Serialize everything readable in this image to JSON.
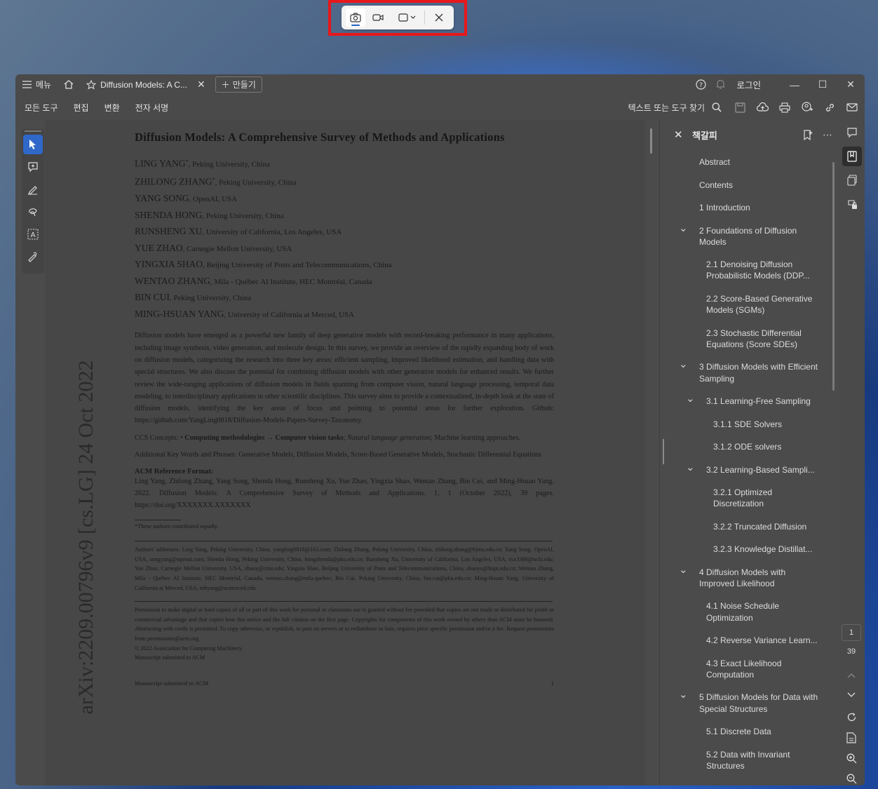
{
  "capture_toolbar": {
    "modes": [
      "camera-icon",
      "video-icon",
      "region-icon"
    ],
    "active_mode": "camera-icon"
  },
  "titlebar": {
    "menu_label": "메뉴",
    "tab_title": "Diffusion Models: A C...",
    "new_tab_label": "만들기",
    "login_label": "로그인"
  },
  "menubar": {
    "items": [
      "모든 도구",
      "편집",
      "변환",
      "전자 서명"
    ],
    "search_placeholder": "텍스트 또는 도구 찾기"
  },
  "document": {
    "arxiv_stamp": "arXiv:2209.00796v9  [cs.LG]  24 Oct 2022",
    "title": "Diffusion Models: A Comprehensive Survey of Methods and Applications",
    "authors": [
      {
        "name": "LING YANG",
        "mark": "*",
        "affil": ", Peking University, China"
      },
      {
        "name": "ZHILONG ZHANG",
        "mark": "*",
        "affil": ", Peking University, China"
      },
      {
        "name": "YANG SONG",
        "mark": "",
        "affil": ", OpenAI, USA"
      },
      {
        "name": "SHENDA HONG",
        "mark": "",
        "affil": ", Peking University, China"
      },
      {
        "name": "RUNSHENG XU",
        "mark": "",
        "affil": ", University of California, Los Angeles, USA"
      },
      {
        "name": "YUE ZHAO",
        "mark": "",
        "affil": ", Carnegie Mellon University, USA"
      },
      {
        "name": "YINGXIA SHAO",
        "mark": "",
        "affil": ", Beijing University of Posts and Telecommunications, China"
      },
      {
        "name": "WENTAO ZHANG",
        "mark": "",
        "affil": ", Mila - Québec AI Institute, HEC Montréal, Canada"
      },
      {
        "name": "BIN CUI",
        "mark": "",
        "affil": ", Peking University, China"
      },
      {
        "name": "MING-HSUAN YANG",
        "mark": "",
        "affil": ", University of California at Merced, USA"
      }
    ],
    "abstract": "Diffusion models have emerged as a powerful new family of deep generative models with record-breaking performance in many applications, including image synthesis, video generation, and molecule design. In this survey, we provide an overview of the rapidly expanding body of work on diffusion models, categorizing the research into three key areas: efficient sampling, improved likelihood estimation, and handling data with special structures. We also discuss the potential for combining diffusion models with other generative models for enhanced results. We further review the wide-ranging applications of diffusion models in fields spanning from computer vision, natural language processing, temporal data modeling, to interdisciplinary applications in other scientific disciplines. This survey aims to provide a contextualized, in-depth look at the state of diffusion models, identifying the key areas of focus and pointing to potential areas for further exploration. Github: https://github.com/YangLing0818/Diffusion-Models-Papers-Survey-Taxonomy.",
    "ccs_label": "CCS Concepts: • ",
    "ccs_bold": "Computing methodologies → Computer vision tasks",
    "ccs_sep": "; ",
    "ccs_italic": "Natural language generation",
    "ccs_rest": "; Machine learning approaches.",
    "keywords": "Additional Key Words and Phrases: Generative Models, Diffusion Models, Score-Based Generative Models, Stochastic Differential Equations",
    "acm_heading": "ACM Reference Format:",
    "acm_text": "Ling Yang, Zhilong Zhang, Yang Song, Shenda Hong, Runsheng Xu, Yue Zhao, Yingxia Shao, Wentao Zhang, Bin Cui, and Ming-Hsuan Yang. 2022. Diffusion Models: A Comprehensive Survey of Methods and Applications.  1, 1 (October 2022), 39 pages. https://doi.org/XXXXXXX.XXXXXXX",
    "footnote": "*These authors contributed equally.",
    "addresses": "Authors' addresses: Ling Yang, Peking University, China, yangling0818@163.com; Zhilong Zhang, Peking University, China, zhilong.zhang@bjmu.edu.cn; Yang Song, OpenAI, USA, songyang@openai.com; Shenda Hong, Peking University, China, hongshenda@pku.edu.cn; Runsheng Xu, University of California, Los Angeles, USA, rxx3386@ucla.edu; Yue Zhao, Carnegie Mellon University, USA, zhaoy@cmu.edu; Yingxia Shao, Beijing University of Posts and Telecommunications, China, shaoyx@bupt.edu.cn; Wentao Zhang, Mila - Québec AI Institute, HEC Montréal, Canada, wentao.zhang@mila.quebec; Bin Cui, Peking University, China, bin.cui@pku.edu.cn; Ming-Hsuan Yang, University of California at Merced, USA, mhyang@ucmerced.edu.",
    "permission": "Permission to make digital or hard copies of all or part of this work for personal or classroom use is granted without fee provided that copies are not made or distributed for profit or commercial advantage and that copies bear this notice and the full citation on the first page. Copyrights for components of this work owned by others than ACM must be honored. Abstracting with credit is permitted. To copy otherwise, or republish, to post on servers or to redistribute to lists, requires prior specific permission and/or a fee. Request permissions from permissions@acm.org.",
    "copyright": "© 2022 Association for Computing Machinery.",
    "manuscript": "Manuscript submitted to ACM",
    "footer_left": "Manuscript submitted to ACM",
    "footer_page": "1"
  },
  "bookmarks": {
    "title": "책갈피",
    "items": [
      {
        "label": "Abstract",
        "level": 0,
        "chevron": false
      },
      {
        "label": "Contents",
        "level": 0,
        "chevron": false
      },
      {
        "label": "1 Introduction",
        "level": 0,
        "chevron": false
      },
      {
        "label": "2 Foundations of Diffusion Models",
        "level": 0,
        "chevron": true
      },
      {
        "label": "2.1 Denoising Diffusion Probabilistic Models (DDP...",
        "level": 1,
        "chevron": false
      },
      {
        "label": "2.2 Score-Based Generative Models (SGMs)",
        "level": 1,
        "chevron": false
      },
      {
        "label": "2.3 Stochastic Differential Equations (Score SDEs)",
        "level": 1,
        "chevron": false
      },
      {
        "label": "3 Diffusion Models with Efficient Sampling",
        "level": 0,
        "chevron": true
      },
      {
        "label": "3.1 Learning-Free Sampling",
        "level": 1,
        "chevron": true
      },
      {
        "label": "3.1.1 SDE Solvers",
        "level": 2,
        "chevron": false
      },
      {
        "label": "3.1.2 ODE solvers",
        "level": 2,
        "chevron": false
      },
      {
        "label": "3.2 Learning-Based Sampli...",
        "level": 1,
        "chevron": true
      },
      {
        "label": "3.2.1 Optimized Discretization",
        "level": 2,
        "chevron": false
      },
      {
        "label": "3.2.2 Truncated Diffusion",
        "level": 2,
        "chevron": false
      },
      {
        "label": "3.2.3 Knowledge Distillat...",
        "level": 2,
        "chevron": false
      },
      {
        "label": "4 Diffusion Models with Improved Likelihood",
        "level": 0,
        "chevron": true
      },
      {
        "label": "4.1 Noise Schedule Optimization",
        "level": 1,
        "chevron": false
      },
      {
        "label": "4.2 Reverse Variance Learn...",
        "level": 1,
        "chevron": false
      },
      {
        "label": "4.3 Exact Likelihood Computation",
        "level": 1,
        "chevron": false
      },
      {
        "label": "5 Diffusion Models for Data with Special Structures",
        "level": 0,
        "chevron": true
      },
      {
        "label": "5.1 Discrete Data",
        "level": 1,
        "chevron": false
      },
      {
        "label": "5.2 Data with Invariant Structures",
        "level": 1,
        "chevron": false
      }
    ]
  },
  "page_nav": {
    "current_page": "1",
    "total_pages": "39"
  },
  "colors": {
    "accent": "#2f68c9",
    "capture_highlight": "#e8171c",
    "window_bg": "#4b4b4b"
  }
}
